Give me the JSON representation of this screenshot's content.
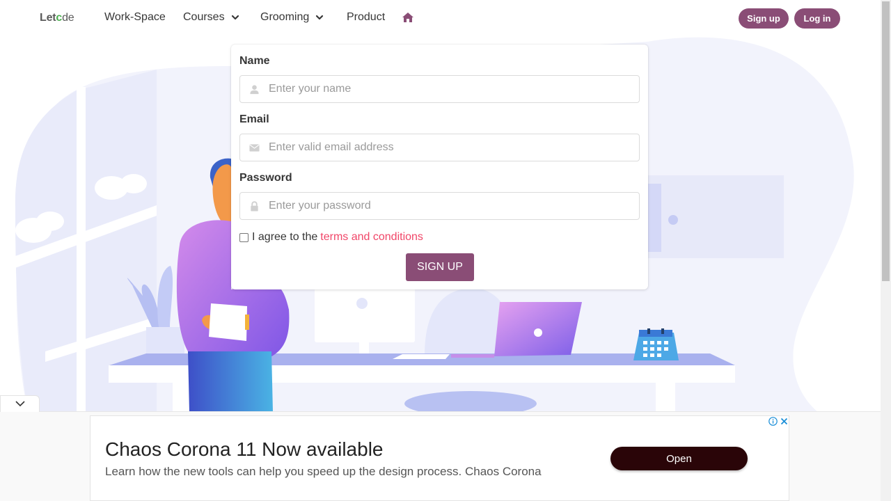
{
  "nav": {
    "logo_part1": "Let",
    "logo_part2": "c",
    "logo_part3": "de",
    "items": [
      {
        "label": "Work-Space"
      },
      {
        "label": "Courses"
      },
      {
        "label": "Grooming"
      },
      {
        "label": "Product"
      }
    ],
    "home_icon": "home-icon",
    "signup_label": "Sign up",
    "login_label": "Log in"
  },
  "form": {
    "name_label": "Name",
    "name_placeholder": "Enter your name",
    "email_label": "Email",
    "email_placeholder": "Enter valid email address",
    "password_label": "Password",
    "password_placeholder": "Enter your password",
    "agree_text": "I agree to the",
    "terms_link": "terms and conditions",
    "submit_label": "SIGN UP"
  },
  "ad": {
    "title": "Chaos Corona 11 Now available",
    "description": "Learn how the new tools can help you speed up the design process. Chaos Corona",
    "open_label": "Open"
  },
  "colors": {
    "brand": "#8a4d76",
    "link": "#f14668",
    "illustration_bg": "#eef0fb"
  }
}
